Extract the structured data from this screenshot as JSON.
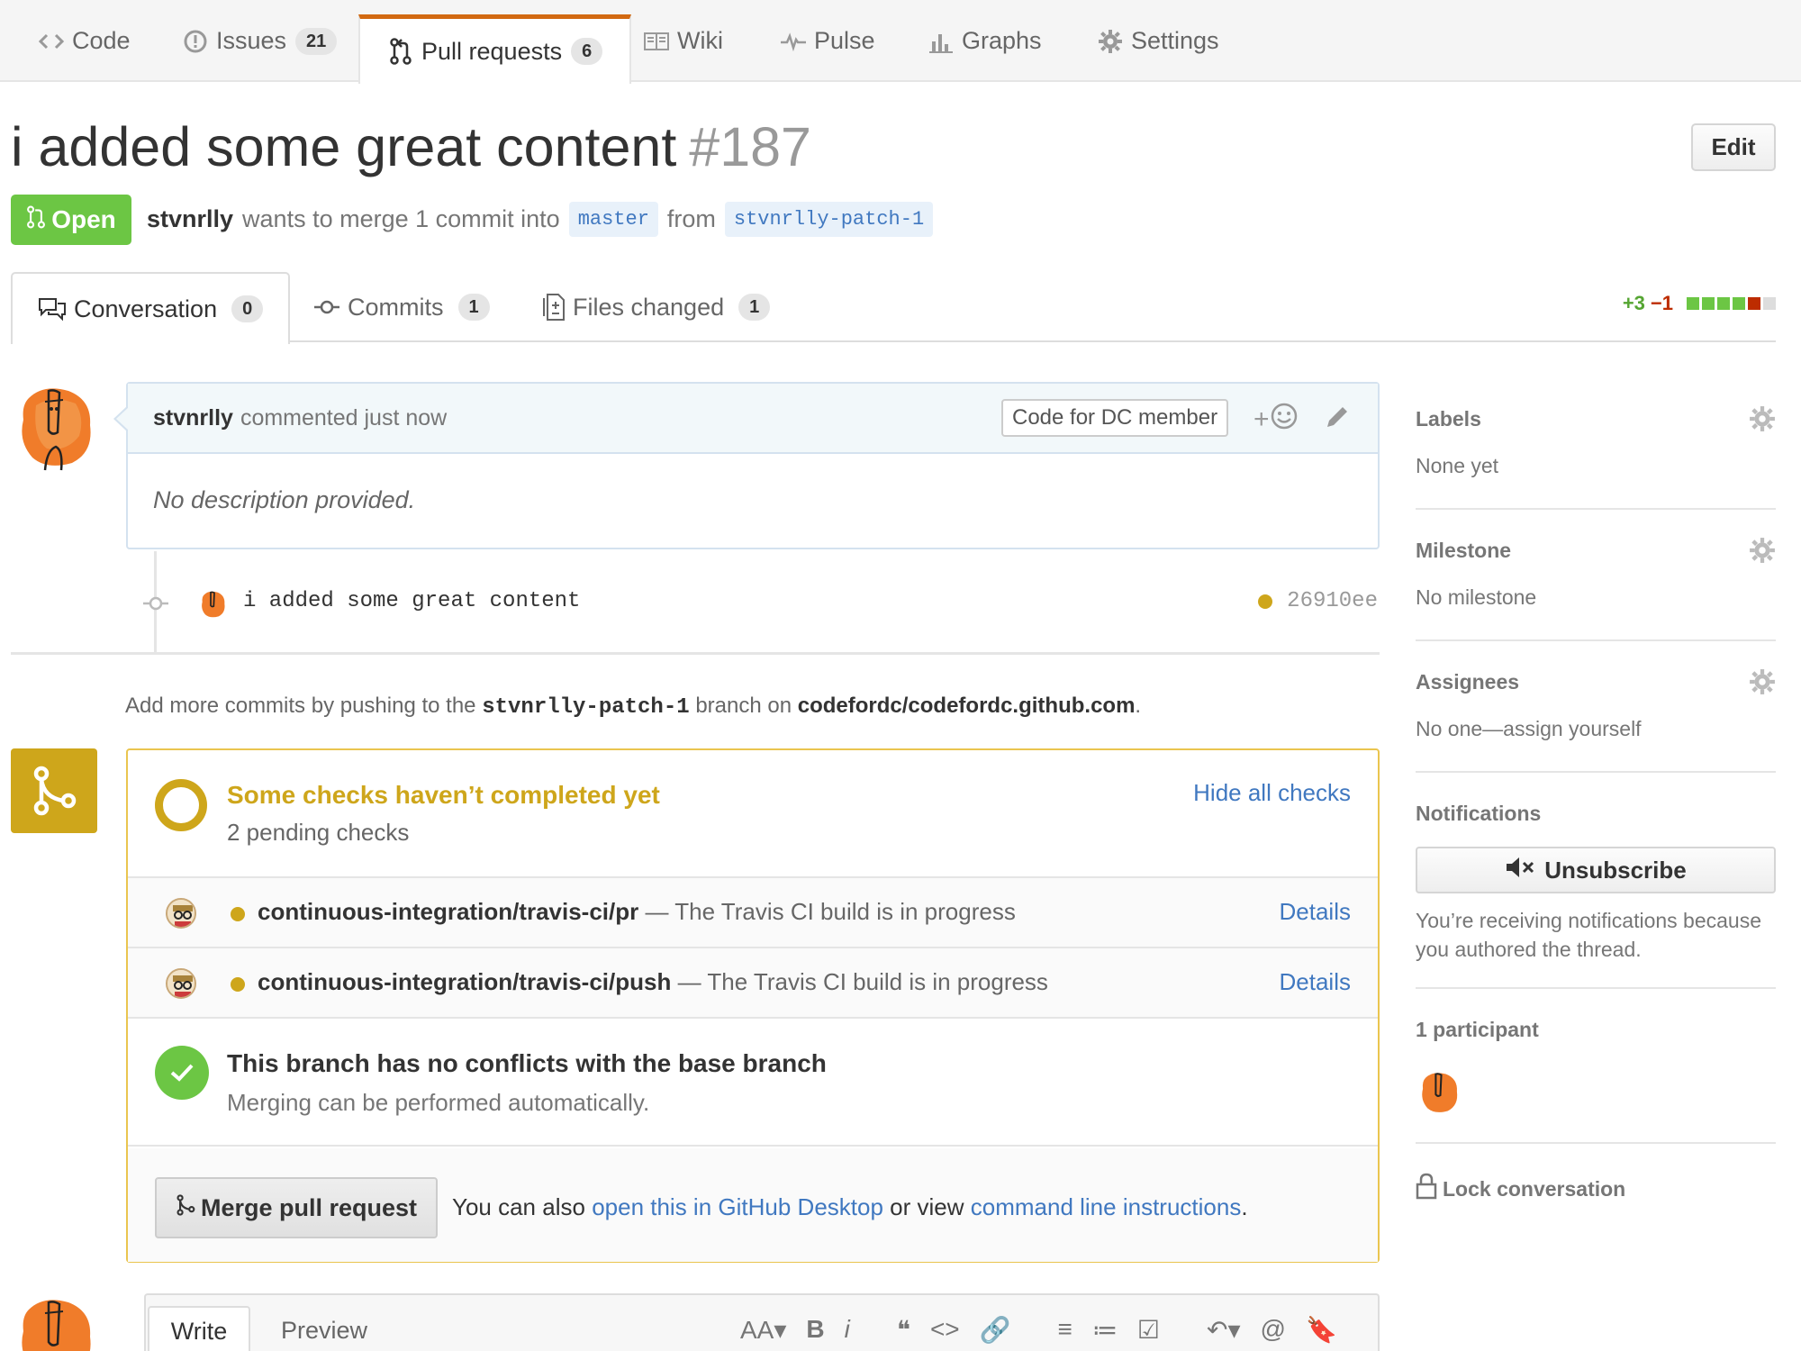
{
  "repo_nav": {
    "tabs": [
      {
        "label": "Code",
        "icon": "code-icon",
        "count": null
      },
      {
        "label": "Issues",
        "icon": "issue-icon",
        "count": "21"
      },
      {
        "label": "Pull requests",
        "icon": "git-pull-request-icon",
        "count": "6"
      },
      {
        "label": "Wiki",
        "icon": "book-icon",
        "count": null
      },
      {
        "label": "Pulse",
        "icon": "pulse-icon",
        "count": null
      },
      {
        "label": "Graphs",
        "icon": "graph-icon",
        "count": null
      },
      {
        "label": "Settings",
        "icon": "gear-icon",
        "count": null
      }
    ],
    "selected": "Pull requests"
  },
  "pr": {
    "title": "i added some great content",
    "number": "#187",
    "edit_label": "Edit",
    "state": "Open",
    "author": "stvnrlly",
    "merge_text": "wants to merge 1 commit into",
    "base_branch": "master",
    "from_text": "from",
    "head_branch": "stvnrlly-patch-1"
  },
  "pr_tabs": [
    {
      "label": "Conversation",
      "count": "0",
      "icon": "comment-discussion-icon"
    },
    {
      "label": "Commits",
      "count": "1",
      "icon": "git-commit-icon"
    },
    {
      "label": "Files changed",
      "count": "1",
      "icon": "diff-icon"
    }
  ],
  "diffstat": {
    "additions": "+3",
    "deletions": "−1",
    "colors": [
      "#6cc644",
      "#6cc644",
      "#6cc644",
      "#6cc644",
      "#bd2c00",
      "#dddddd"
    ]
  },
  "comment": {
    "author": "stvnrlly",
    "action": "commented just now",
    "badge": "Code for DC member",
    "react": "+",
    "body": "No description provided."
  },
  "commit": {
    "message": "i added some great content",
    "sha": "26910ee"
  },
  "push_note": {
    "prefix": "Add more commits by pushing to the",
    "branch": "stvnrlly-patch-1",
    "middle": "branch on",
    "repo": "codefordc/codefordc.github.com",
    "suffix": "."
  },
  "checks": {
    "title": "Some checks haven’t completed yet",
    "subtitle": "2 pending checks",
    "toggle": "Hide all checks",
    "items": [
      {
        "name": "continuous-integration/travis-ci/pr",
        "desc": "— The Travis CI build is in progress",
        "link": "Details"
      },
      {
        "name": "continuous-integration/travis-ci/push",
        "desc": "— The Travis CI build is in progress",
        "link": "Details"
      }
    ]
  },
  "conflicts": {
    "title": "This branch has no conflicts with the base branch",
    "subtitle": "Merging can be performed automatically."
  },
  "merge": {
    "button": "Merge pull request",
    "alt_prefix": "You can also",
    "alt_link1": "open this in GitHub Desktop",
    "alt_mid": "or view",
    "alt_link2": "command line instructions",
    "alt_suffix": "."
  },
  "composer": {
    "write": "Write",
    "preview": "Preview",
    "tools": [
      "AA▾",
      "B",
      "i",
      "❝",
      "<>",
      "🔗",
      "≡",
      "≔",
      "☑",
      "↶▾",
      "@",
      "🔖"
    ]
  },
  "sidebar": {
    "labels_title": "Labels",
    "labels_value": "None yet",
    "milestone_title": "Milestone",
    "milestone_value": "No milestone",
    "assignees_title": "Assignees",
    "assignees_value": "No one—assign yourself",
    "notifications_title": "Notifications",
    "unsubscribe": "Unsubscribe",
    "notifications_reason": "You’re receiving notifications because you authored the thread.",
    "participants_title": "1 participant",
    "lock": "Lock conversation"
  }
}
